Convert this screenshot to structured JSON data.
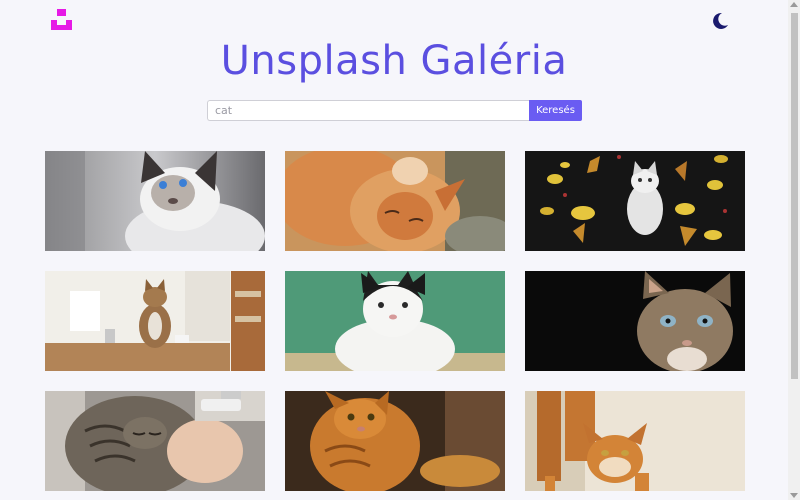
{
  "header": {
    "logo_icon": "unsplash-logo-icon",
    "logo_color": "#e619e6",
    "theme_toggle_icon": "moon-icon",
    "theme_toggle_color": "#1a1a6e",
    "title": "Unsplash Galéria",
    "title_color": "#5b4fe0"
  },
  "search": {
    "value": "",
    "placeholder": "cat",
    "button_label": "Keresés",
    "button_color": "#6a5cf2"
  },
  "gallery": {
    "photos": [
      {
        "subject": "white siamese cat looking up"
      },
      {
        "subject": "orange tabby cat lying on back"
      },
      {
        "subject": "white kitten among autumn leaves"
      },
      {
        "subject": "tabby cat sitting on kitchen table"
      },
      {
        "subject": "black and white cat on green wall"
      },
      {
        "subject": "tabby cat on black background"
      },
      {
        "subject": "sleeping tabby cat held by hand"
      },
      {
        "subject": "orange cat in sunlight"
      },
      {
        "subject": "orange cat stretching"
      }
    ]
  }
}
